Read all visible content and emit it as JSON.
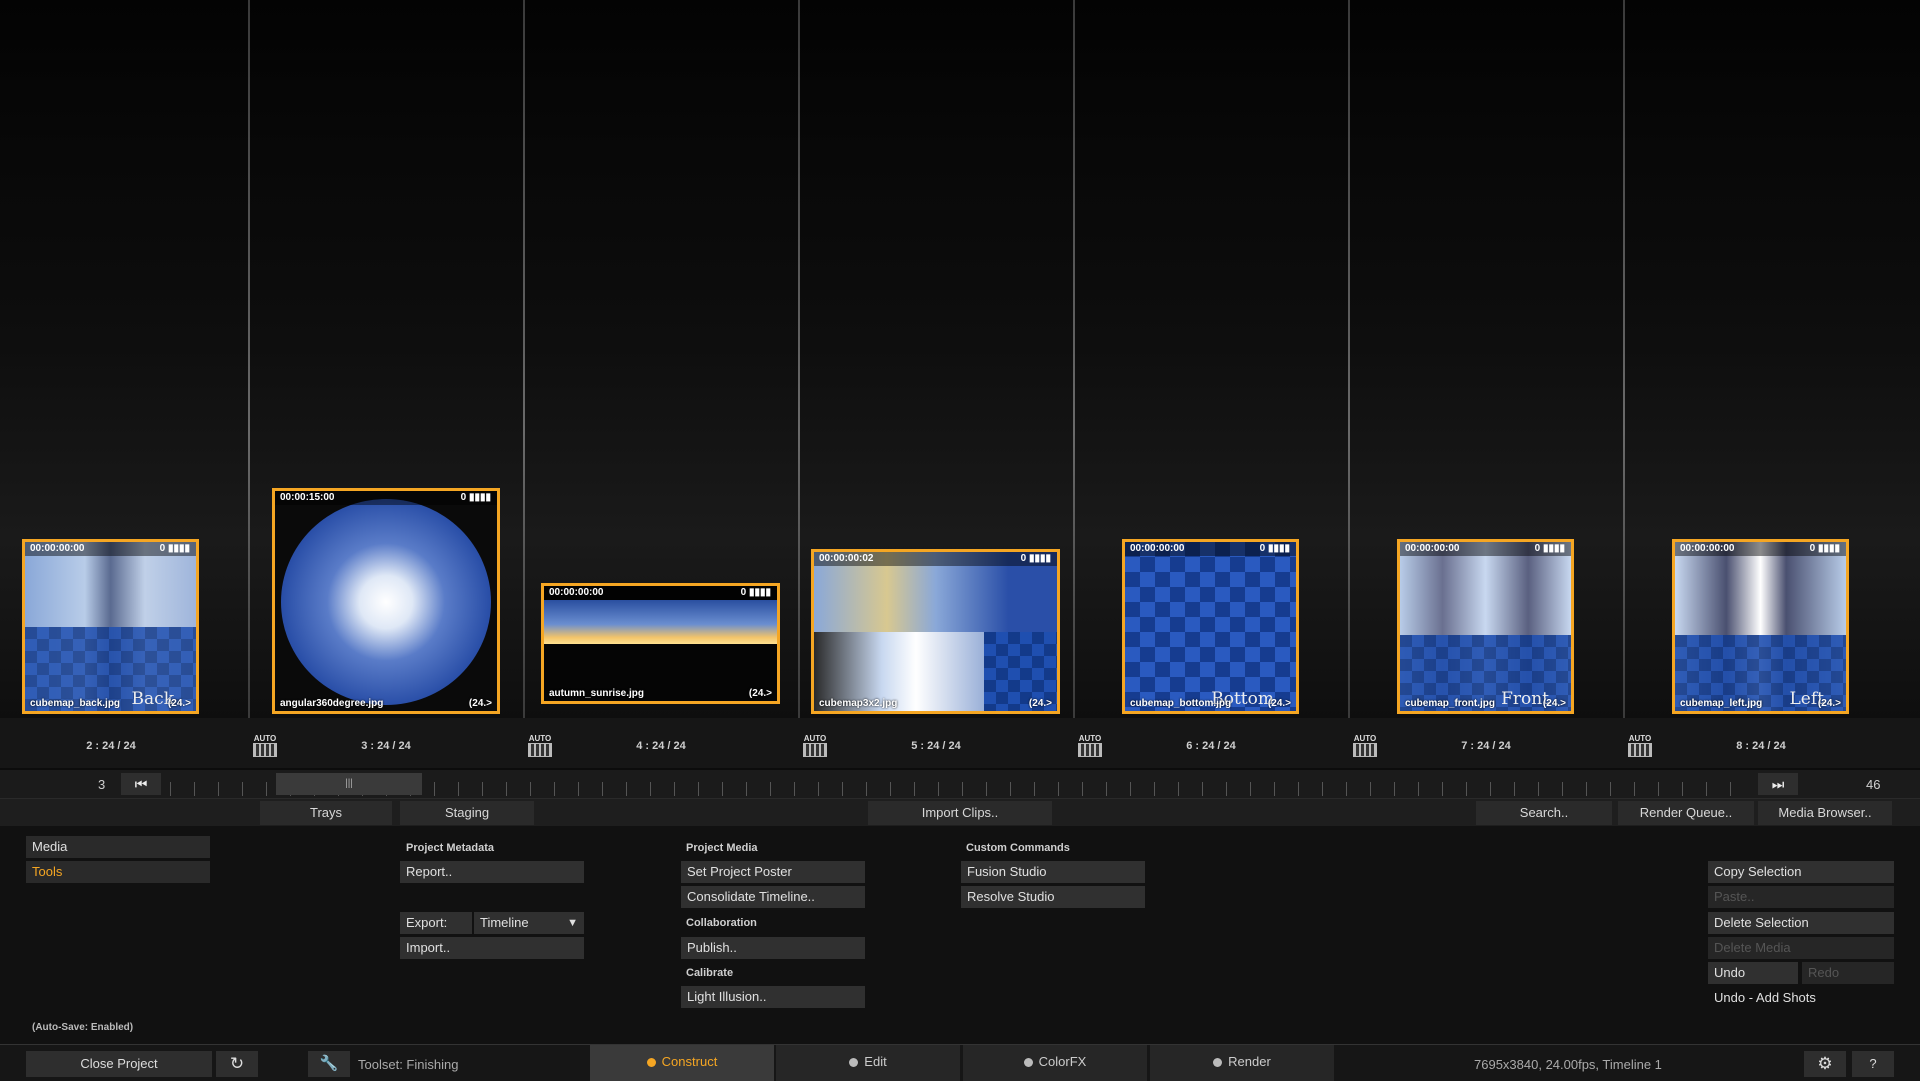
{
  "clips": [
    {
      "timecode": "00:00:00:00",
      "meta": "0 ▮▮▮▮",
      "filename": "cubemap_back.jpg",
      "rate": "(24.>",
      "face": "Back",
      "shot": "2 : 24 / 24"
    },
    {
      "timecode": "00:00:15:00",
      "meta": "0 ▮▮▮▮",
      "filename": "angular360degree.jpg",
      "rate": "(24.>",
      "face": "",
      "shot": "3 : 24 / 24"
    },
    {
      "timecode": "00:00:00:00",
      "meta": "0 ▮▮▮▮",
      "filename": "autumn_sunrise.jpg",
      "rate": "(24.>",
      "face": "",
      "shot": "4 : 24 / 24"
    },
    {
      "timecode": "00:00:00:02",
      "meta": "0 ▮▮▮▮",
      "filename": "cubemap3x2.jpg",
      "rate": "(24.>",
      "face": "",
      "shot": "5 : 24 / 24"
    },
    {
      "timecode": "00:00:00:00",
      "meta": "0 ▮▮▮▮",
      "filename": "cubemap_bottom.jpg",
      "rate": "(24.>",
      "face": "Bottom",
      "shot": "6 : 24 / 24"
    },
    {
      "timecode": "00:00:00:00",
      "meta": "0 ▮▮▮▮",
      "filename": "cubemap_front.jpg",
      "rate": "(24.>",
      "face": "Front",
      "shot": "7 : 24 / 24"
    },
    {
      "timecode": "00:00:00:00",
      "meta": "0 ▮▮▮▮",
      "filename": "cubemap_left.jpg",
      "rate": "(24.>",
      "face": "Left",
      "shot": "8 : 24 / 24"
    }
  ],
  "auto_label": "AUTO",
  "scrubber": {
    "left_number": "3",
    "right_number": "46",
    "thumb": "|||"
  },
  "tabs": {
    "trays": "Trays",
    "staging": "Staging",
    "import_clips": "Import Clips..",
    "search": "Search..",
    "render_queue": "Render Queue..",
    "media_browser": "Media Browser.."
  },
  "sidebar": {
    "media": "Media",
    "tools": "Tools"
  },
  "project_metadata": {
    "header": "Project Metadata",
    "report": "Report..",
    "export_label": "Export:",
    "export_value": "Timeline",
    "import": "Import.."
  },
  "project_media": {
    "header": "Project Media",
    "set_poster": "Set Project Poster",
    "consolidate": "Consolidate Timeline..",
    "collab_header": "Collaboration",
    "publish": "Publish..",
    "calibrate_header": "Calibrate",
    "light_illusion": "Light Illusion.."
  },
  "custom_commands": {
    "header": "Custom Commands",
    "fusion": "Fusion Studio",
    "resolve": "Resolve Studio"
  },
  "edit_actions": {
    "copy": "Copy Selection",
    "paste": "Paste..",
    "delete_selection": "Delete Selection",
    "delete_media": "Delete Media",
    "undo": "Undo",
    "redo": "Redo",
    "undo_status": "Undo - Add Shots"
  },
  "autosave": "(Auto-Save: Enabled)",
  "bottom": {
    "close_project": "Close Project",
    "toolset": "Toolset: Finishing",
    "construct": "Construct",
    "edit": "Edit",
    "colorfx": "ColorFX",
    "render": "Render",
    "status": "7695x3840, 24.00fps, Timeline 1",
    "help": "?"
  },
  "colors": {
    "accent": "#f5a623",
    "background": "#0c0c0c"
  }
}
